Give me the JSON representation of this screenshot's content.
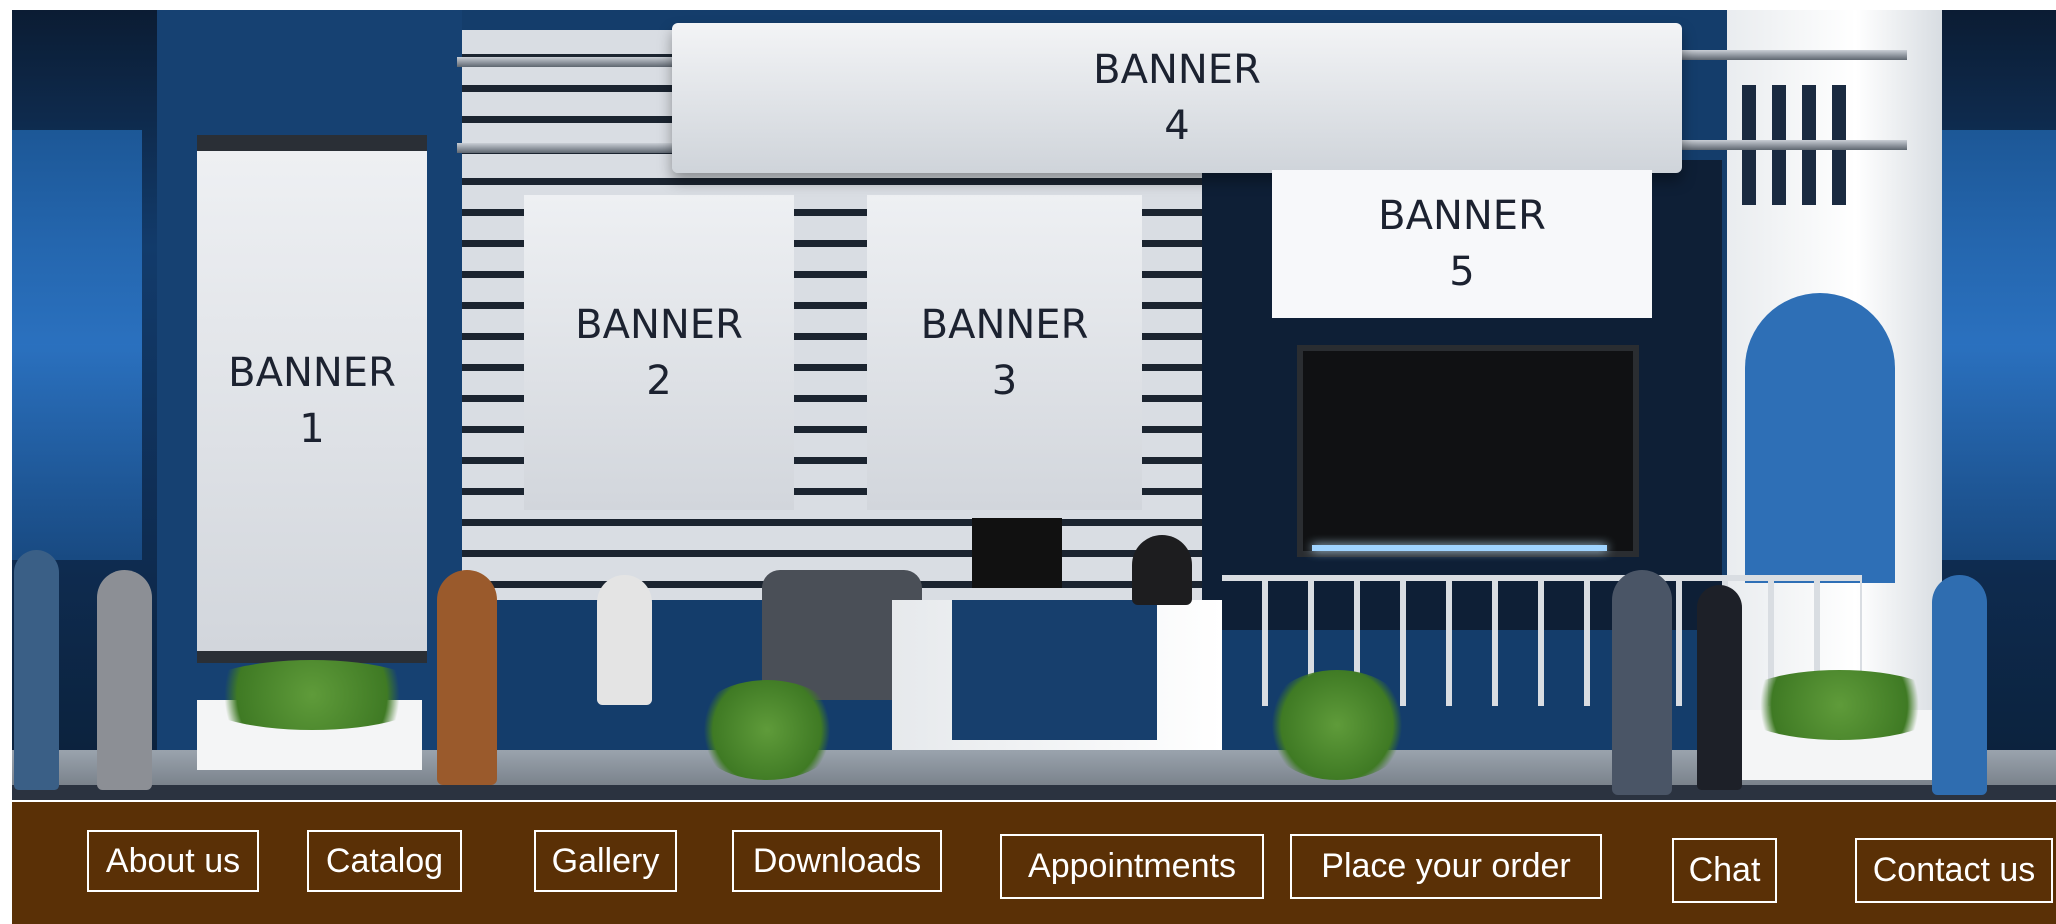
{
  "banners": {
    "b1": {
      "line1": "BANNER",
      "line2": "1"
    },
    "b2": {
      "line1": "BANNER",
      "line2": "2"
    },
    "b3": {
      "line1": "BANNER",
      "line2": "3"
    },
    "b4": {
      "line1": "BANNER",
      "line2": "4"
    },
    "b5": {
      "line1": "BANNER",
      "line2": "5"
    }
  },
  "nav": {
    "about": "About us",
    "catalog": "Catalog",
    "gallery": "Gallery",
    "downloads": "Downloads",
    "appointments": "Appointments",
    "order": "Place your order",
    "chat": "Chat",
    "contact": "Contact us"
  },
  "colors": {
    "nav_background": "#5a3006",
    "booth_blue": "#164172",
    "banner_text": "#1c2230"
  }
}
